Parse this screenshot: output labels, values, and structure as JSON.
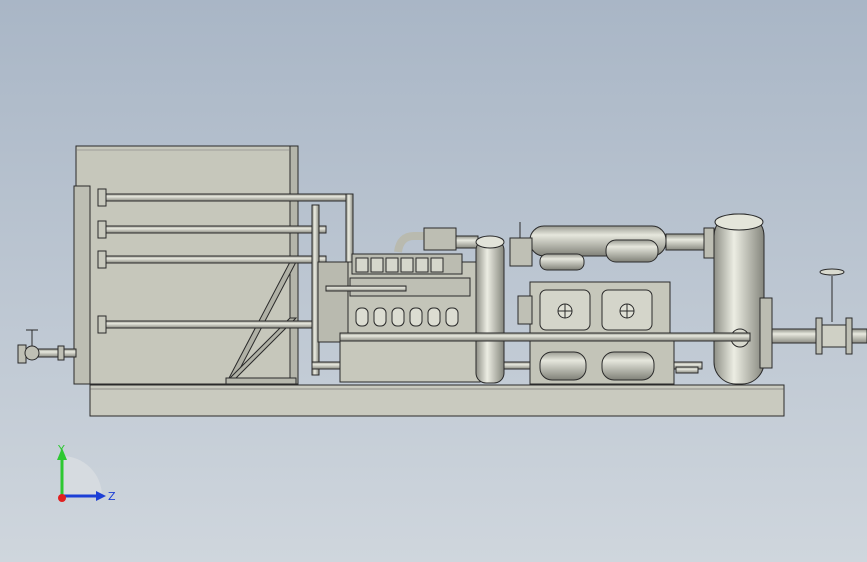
{
  "viewport": {
    "background_top": "#a9b6c6",
    "background_bottom": "#cfd6dd",
    "model_fill": "#c8c9bd",
    "model_line": "#2a2a2a"
  },
  "triad": {
    "y_label": "Y",
    "z_label": "Z",
    "y_axis_color": "#2ec832",
    "z_axis_color": "#1c3fd6",
    "origin_color": "#e02020"
  }
}
